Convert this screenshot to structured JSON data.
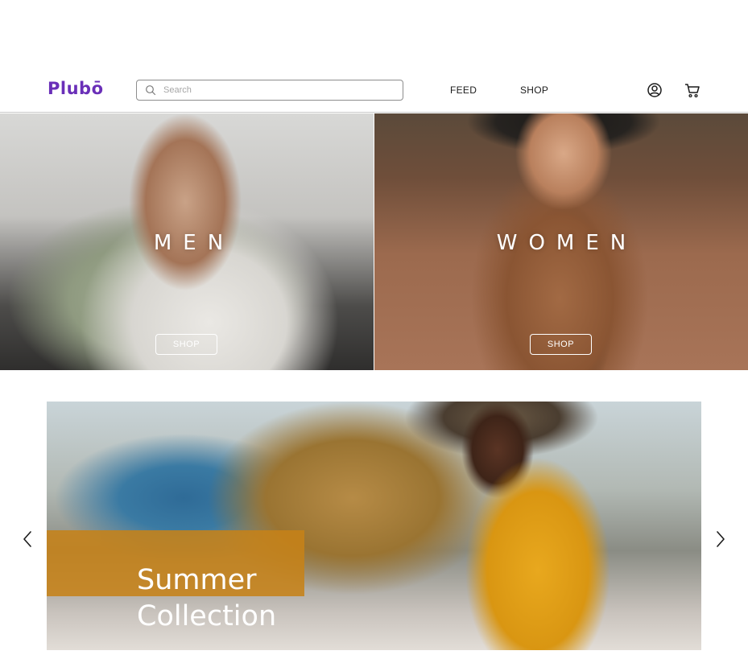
{
  "header": {
    "logo": "Plubō",
    "search": {
      "placeholder": "Search",
      "value": ""
    },
    "nav": {
      "feed": "FEED",
      "shop": "SHOP"
    },
    "icons": {
      "search": "search-icon",
      "account": "user-circle-icon",
      "cart": "cart-icon"
    }
  },
  "heroes": {
    "men": {
      "title": "MEN",
      "button": "SHOP"
    },
    "women": {
      "title": "WOMEN",
      "button": "SHOP"
    }
  },
  "carousel": {
    "title": "Summer\nCollection",
    "prev_icon": "chevron-left-icon",
    "next_icon": "chevron-right-icon"
  },
  "colors": {
    "brand": "#6a2fb8",
    "accent_band": "#c68218",
    "text_dark": "#1b1b1b"
  }
}
